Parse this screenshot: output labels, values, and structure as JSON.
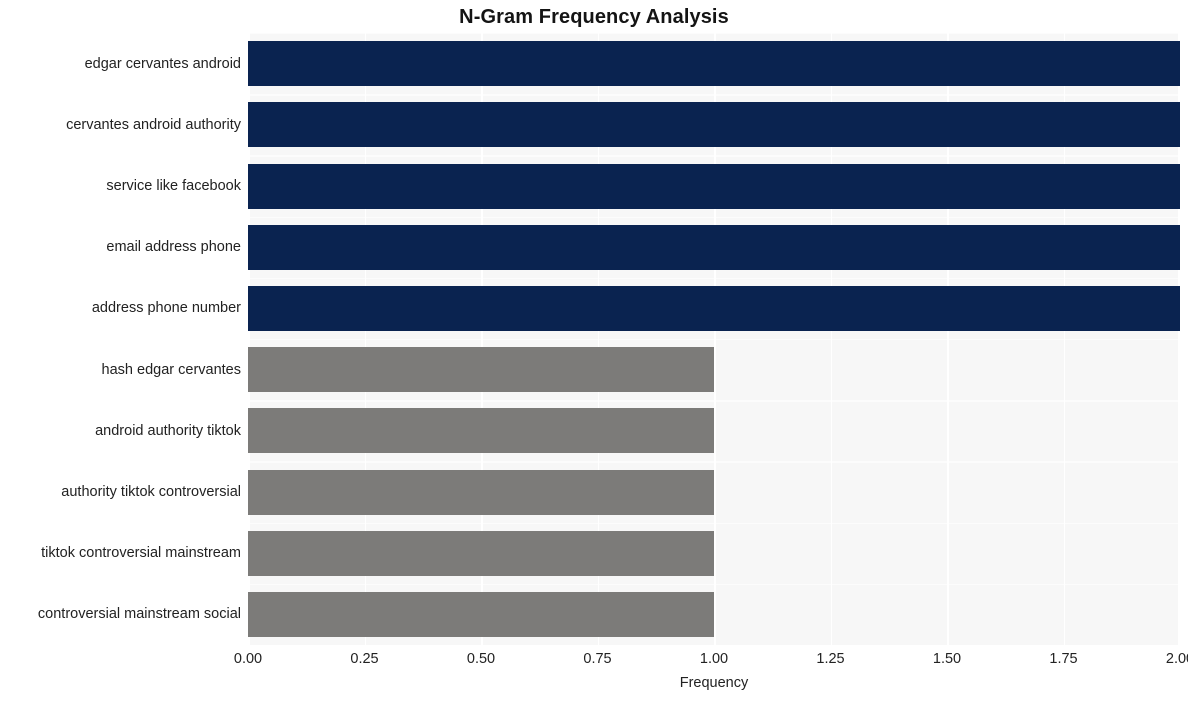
{
  "chart_data": {
    "type": "bar",
    "orientation": "horizontal",
    "title": "N-Gram Frequency Analysis",
    "xlabel": "Frequency",
    "ylabel": "",
    "xlim": [
      0,
      2
    ],
    "xticks": [
      "0.00",
      "0.25",
      "0.50",
      "0.75",
      "1.00",
      "1.25",
      "1.50",
      "1.75",
      "2.00"
    ],
    "xtick_values": [
      0,
      0.25,
      0.5,
      0.75,
      1.0,
      1.25,
      1.5,
      1.75,
      2.0
    ],
    "grid": true,
    "legend": "none",
    "categories": [
      "edgar cervantes android",
      "cervantes android authority",
      "service like facebook",
      "email address phone",
      "address phone number",
      "hash edgar cervantes",
      "android authority tiktok",
      "authority tiktok controversial",
      "tiktok controversial mainstream",
      "controversial mainstream social"
    ],
    "values": [
      2,
      2,
      2,
      2,
      2,
      1,
      1,
      1,
      1,
      1
    ],
    "bar_colors": [
      "#0a2350",
      "#0a2350",
      "#0a2350",
      "#0a2350",
      "#0a2350",
      "#7c7b79",
      "#7c7b79",
      "#7c7b79",
      "#7c7b79",
      "#7c7b79"
    ]
  },
  "style": {
    "plot_background": "#f7f7f7",
    "figure_background": "#ffffff",
    "gridline_color": "#ffffff",
    "text_color": "#222222",
    "title_color": "#141414",
    "accent_high": "#0a2350",
    "accent_low": "#7c7b79"
  }
}
